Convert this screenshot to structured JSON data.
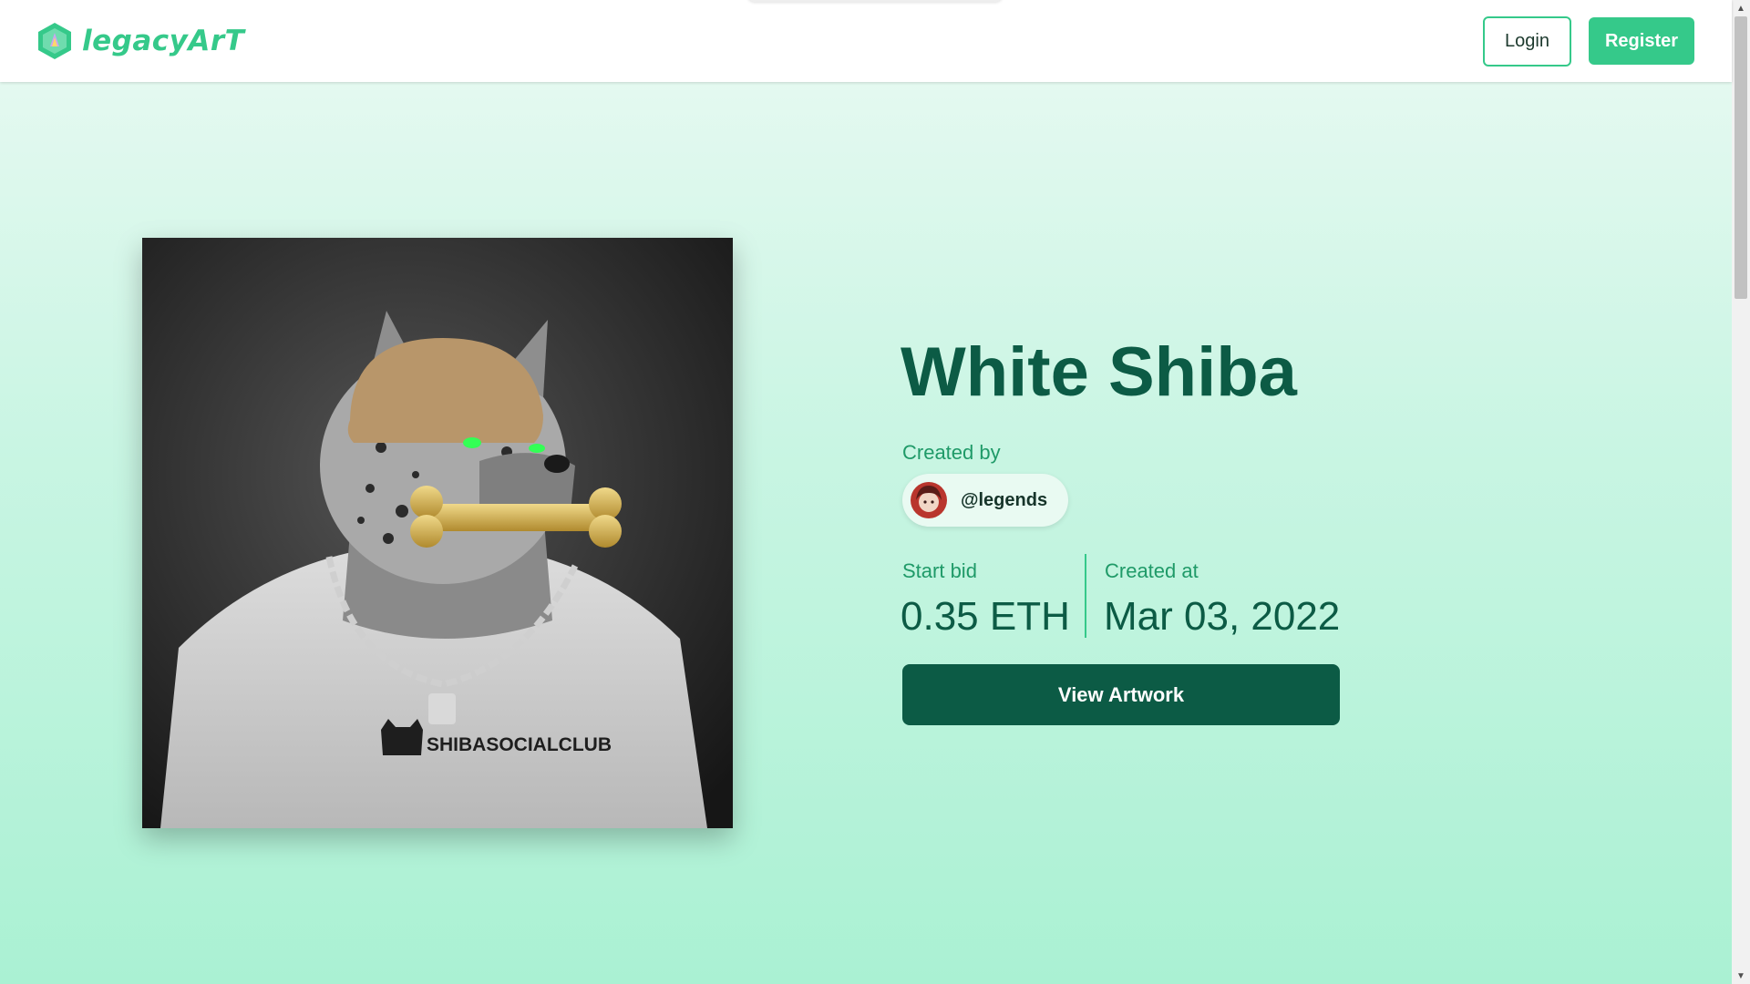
{
  "header": {
    "logo_text": "legacyArT",
    "login_label": "Login",
    "register_label": "Register"
  },
  "artwork": {
    "title": "White Shiba",
    "created_by_label": "Created by",
    "creator_handle": "@legends",
    "start_bid_label": "Start bid",
    "start_bid_value": "0.35 ETH",
    "created_at_label": "Created at",
    "created_at_value": "Mar 03, 2022",
    "view_button_label": "View Artwork",
    "shirt_text": "SHIBASOCIALCLUB"
  },
  "colors": {
    "accent": "#35c98a",
    "primary_dark": "#0c5b45",
    "label_green": "#1f9a68"
  }
}
